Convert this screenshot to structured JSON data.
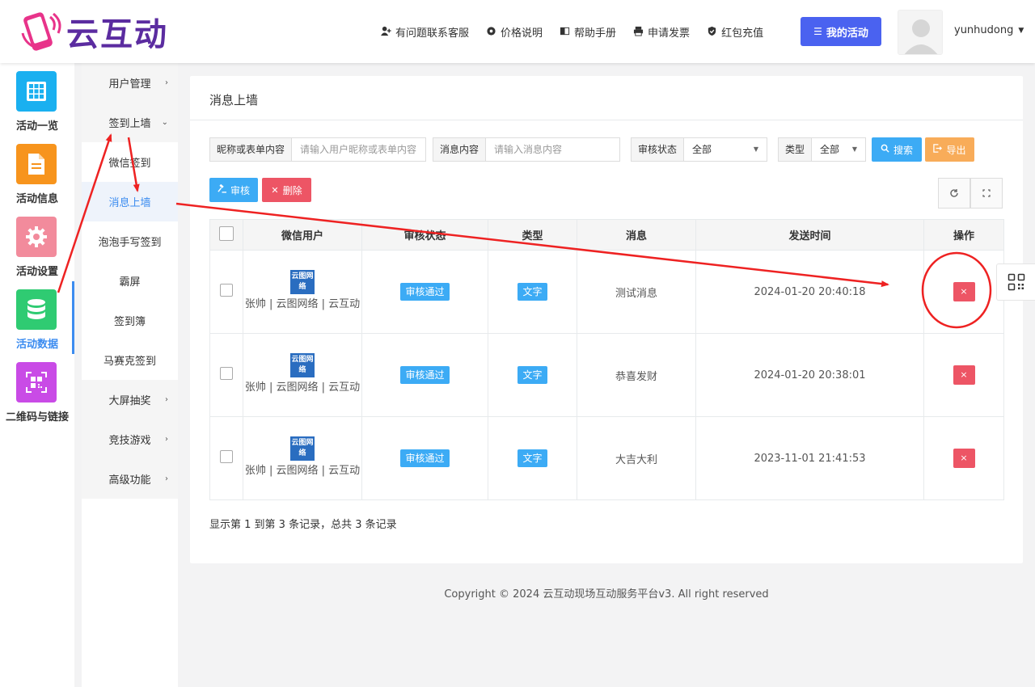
{
  "brand": {
    "name": "云互动"
  },
  "top_nav": {
    "items": [
      {
        "label": "有问题联系客服",
        "icon": "user-plus-icon"
      },
      {
        "label": "价格说明",
        "icon": "gear-icon"
      },
      {
        "label": "帮助手册",
        "icon": "book-icon"
      },
      {
        "label": "申请发票",
        "icon": "printer-icon"
      },
      {
        "label": "红包充值",
        "icon": "shield-check-icon"
      }
    ],
    "my_activity": "我的活动",
    "username": "yunhudong"
  },
  "rail": {
    "items": [
      {
        "label": "活动一览",
        "icon": "grid-icon",
        "color": "#1ab0f0"
      },
      {
        "label": "活动信息",
        "icon": "document-icon",
        "color": "#f7941d"
      },
      {
        "label": "活动设置",
        "icon": "gear-icon",
        "color": "#f28b9c"
      },
      {
        "label": "活动数据",
        "icon": "database-icon",
        "color": "#2fcb72"
      },
      {
        "label": "二维码与链接",
        "icon": "qrcode-icon",
        "color": "#c94be6"
      }
    ]
  },
  "submenu": {
    "items": [
      {
        "label": "用户管理",
        "chevron": "›"
      },
      {
        "label": "签到上墙",
        "chevron": "⌄"
      },
      {
        "label": "微信签到"
      },
      {
        "label": "消息上墙"
      },
      {
        "label": "泡泡手写签到"
      },
      {
        "label": "霸屏"
      },
      {
        "label": "签到簿"
      },
      {
        "label": "马赛克签到"
      },
      {
        "label": "大屏抽奖",
        "chevron": "›"
      },
      {
        "label": "竞技游戏",
        "chevron": "›"
      },
      {
        "label": "高级功能",
        "chevron": "›"
      }
    ]
  },
  "main": {
    "title": "消息上墙",
    "filters": {
      "nickname_label": "昵称或表单内容",
      "nickname_placeholder": "请输入用户昵称或表单内容",
      "message_label": "消息内容",
      "message_placeholder": "请输入消息内容",
      "status_label": "审核状态",
      "status_value": "全部",
      "type_label": "类型",
      "type_value": "全部",
      "search_label": "搜索",
      "export_label": "导出"
    },
    "actions": {
      "approve_label": "审核",
      "delete_label": "删除"
    },
    "table": {
      "headers": [
        "微信用户",
        "审核状态",
        "类型",
        "消息",
        "发送时间",
        "操作"
      ],
      "rows": [
        {
          "user_logo": "云图网络",
          "user": "张帅 | 云图网络 | 云互动",
          "status": "审核通过",
          "type": "文字",
          "message": "测试消息",
          "time": "2024-01-20 20:40:18"
        },
        {
          "user_logo": "云图网络",
          "user": "张帅 | 云图网络 | 云互动",
          "status": "审核通过",
          "type": "文字",
          "message": "恭喜发财",
          "time": "2024-01-20 20:38:01"
        },
        {
          "user_logo": "云图网络",
          "user": "张帅 | 云图网络 | 云互动",
          "status": "审核通过",
          "type": "文字",
          "message": "大吉大利",
          "time": "2023-11-01 21:41:53"
        }
      ],
      "delete_glyph": "×"
    },
    "pager": "显示第 1 到第 3 条记录，总共 3 条记录"
  },
  "footer": {
    "copyright": "Copyright © 2024 云互动现场互动服务平台v3. All right reserved"
  }
}
